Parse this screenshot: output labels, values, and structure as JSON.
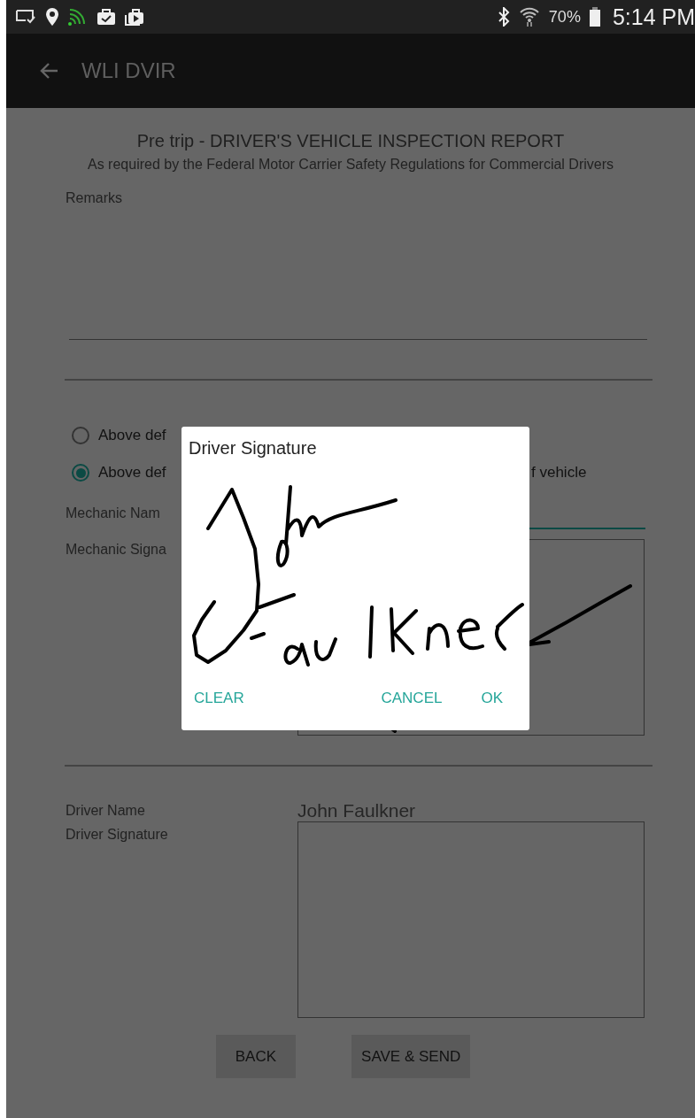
{
  "status_bar": {
    "battery": "70%",
    "time": "5:14 PM"
  },
  "app_bar": {
    "title": "WLI DVIR"
  },
  "form": {
    "title": "Pre trip - DRIVER'S VEHICLE INSPECTION REPORT",
    "subtitle": "As required by the Federal Motor Carrier Safety Regulations for Commercial Drivers",
    "remarks_label": "Remarks",
    "radios": [
      {
        "label": "Above def",
        "selected": false
      },
      {
        "label": "Above def",
        "trailing": "f vehicle",
        "selected": true
      }
    ],
    "mechanic_name_label": "Mechanic Nam",
    "mechanic_signature_label": "Mechanic Signa",
    "driver_name_label": "Driver Name",
    "driver_name": "John Faulkner",
    "driver_signature_label": "Driver Signature",
    "buttons": [
      "BACK",
      "SAVE & SEND"
    ]
  },
  "dialog": {
    "title": "Driver Signature",
    "left_buttons": [
      "CLEAR"
    ],
    "right_buttons": [
      "CANCEL",
      "OK"
    ]
  }
}
